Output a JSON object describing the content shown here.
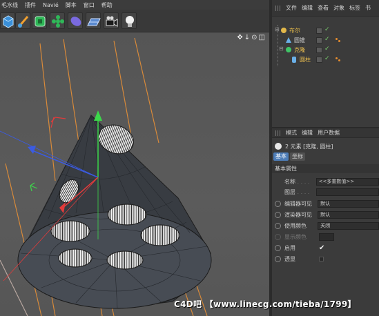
{
  "menu": [
    "毛水线",
    "插件",
    "Navié",
    "脚本",
    "窗口",
    "帮助"
  ],
  "toolbar": {
    "tools": [
      "cube-tool-icon",
      "pen-tool-icon",
      "subdivision-tool-icon",
      "flower-array-icon",
      "deformer-icon",
      "floor-icon",
      "camera-icon",
      "light-icon"
    ]
  },
  "viewport": {
    "nav_icons": "✥↓⊙◫"
  },
  "object_manager": {
    "tabs": [
      "文件",
      "编辑",
      "查看",
      "对象",
      "标签",
      "书"
    ],
    "objects": [
      {
        "name": "布尔",
        "color": "#e2b84a",
        "indent": 0
      },
      {
        "name": "圆锥",
        "color": "#d8d8d8",
        "indent": 1
      },
      {
        "name": "克隆",
        "color": "#f0c24f",
        "indent": 1
      },
      {
        "name": "圆柱",
        "color": "#f0c24f",
        "indent": 2
      }
    ]
  },
  "attribute_manager": {
    "tabs": [
      "模式",
      "编辑",
      "用户数据"
    ],
    "selection_label": "2 元素 [克隆, 圆柱]",
    "subtabs": [
      "基本",
      "坐标"
    ],
    "section_title": "基本属性",
    "fields": [
      {
        "label": "名称",
        "value": "<<多重数值>>",
        "type": "text",
        "radio": false
      },
      {
        "label": "图层",
        "value": "",
        "type": "text",
        "radio": false
      },
      {
        "label": "编辑器可见",
        "value": "默认",
        "type": "select",
        "radio": true
      },
      {
        "label": "渲染器可见",
        "value": "默认",
        "type": "select",
        "radio": true
      },
      {
        "label": "使用颜色",
        "value": "关闭",
        "type": "select",
        "radio": true
      },
      {
        "label": "显示颜色",
        "value": "",
        "type": "color",
        "radio": true
      },
      {
        "label": "启用",
        "value": "✔",
        "type": "check",
        "radio": true
      },
      {
        "label": "透显",
        "value": "",
        "type": "check",
        "radio": true
      }
    ]
  },
  "watermark": "C4D吧 【www.linecg.com/tieba/1799】",
  "colors": {
    "accent_blue": "#4d7db8",
    "axis_x": "#e23b3b",
    "axis_y": "#3bd84a",
    "axis_z": "#3b5be2",
    "spline": "#d88a3a"
  }
}
